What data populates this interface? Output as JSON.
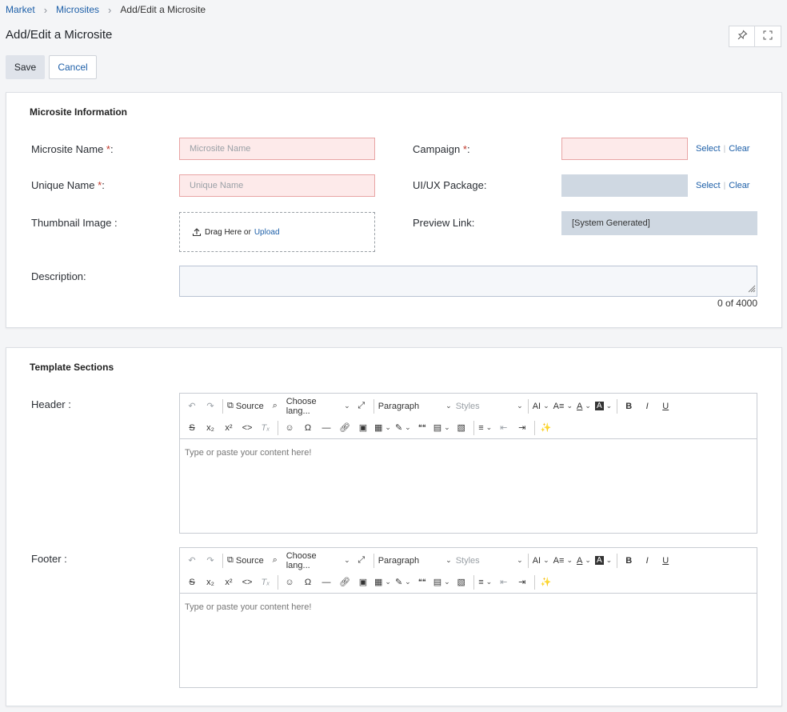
{
  "breadcrumb": {
    "items": [
      "Market",
      "Microsites",
      "Add/Edit a Microsite"
    ]
  },
  "page": {
    "title": "Add/Edit a Microsite"
  },
  "toolbar": {
    "save_label": "Save",
    "cancel_label": "Cancel",
    "icons": [
      "pin-icon",
      "fullscreen-icon"
    ]
  },
  "microsite_info": {
    "title": "Microsite Information",
    "name_label": "Microsite Name",
    "name_placeholder": "Microsite Name",
    "unique_label": "Unique Name",
    "unique_placeholder": "Unique Name",
    "thumbnail_label": "Thumbnail Image :",
    "drag_text": "Drag Here or",
    "upload_label": "Upload",
    "campaign_label": "Campaign",
    "uiux_label": "UI/UX Package:",
    "preview_label": "Preview Link:",
    "preview_value": "[System Generated]",
    "description_label": "Description:",
    "char_counter": "0 of 4000",
    "required_mark": "*",
    "colon": ":",
    "select_label": "Select",
    "clear_label": "Clear",
    "separator": "|"
  },
  "template_sections": {
    "title": "Template Sections",
    "header_label": "Header :",
    "footer_label": "Footer :"
  },
  "editor": {
    "source_label": "Source",
    "language_label": "Choose lang...",
    "paragraph_label": "Paragraph",
    "styles_label": "Styles",
    "placeholder": "Type or paste your content here!",
    "bold": "B",
    "italic": "I",
    "underline": "U",
    "superscript": "x²",
    "subscript": "x₂",
    "omega": "Ω",
    "quote": "❝❝",
    "code": "<>",
    "font_size": "AI",
    "font_color": "A"
  },
  "colors": {
    "link": "#1d5fa8",
    "required": "#c0392b",
    "error_field_bg": "#fdeaea",
    "error_field_border": "#e8a5a5",
    "readonly_bg": "#cfd8e2"
  }
}
